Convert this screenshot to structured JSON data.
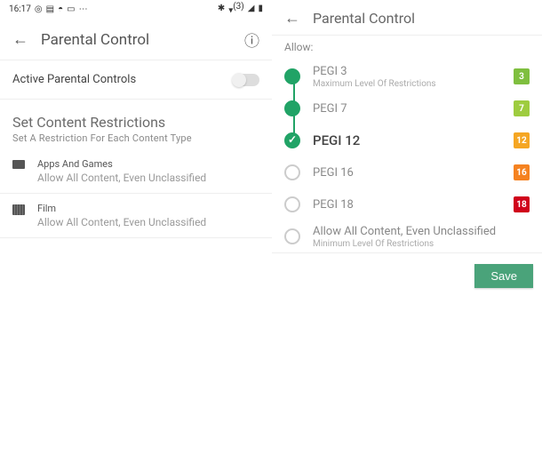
{
  "left": {
    "status": {
      "time": "16:17",
      "bt": "✱",
      "wifi_badge": "(3)"
    },
    "header": {
      "title": "Parental Control"
    },
    "toggle": {
      "label": "Active Parental Controls"
    },
    "section": {
      "title": "Set Content Restrictions",
      "subtitle": "Set A Restriction For Each Content Type"
    },
    "rows": [
      {
        "title": "Apps And Games",
        "sub": "Allow All Content, Even Unclassified"
      },
      {
        "title": "Film",
        "sub": "Allow All Content, Even Unclassified"
      }
    ]
  },
  "right": {
    "header": {
      "title": "Parental Control"
    },
    "allow_label": "Allow:",
    "options": [
      {
        "label": "PEGI 3",
        "sub": "Maximum Level Of Restrictions",
        "badge": "3",
        "badge_class": "g3",
        "state": "filled",
        "connect": true
      },
      {
        "label": "PEGI 7",
        "sub": "",
        "badge": "7",
        "badge_class": "g7",
        "state": "filled",
        "connect": true
      },
      {
        "label": "PEGI 12",
        "sub": "",
        "badge": "12",
        "badge_class": "g12",
        "state": "checked",
        "selected": true,
        "connect": false
      },
      {
        "label": "PEGI 16",
        "sub": "",
        "badge": "16",
        "badge_class": "g16",
        "state": "empty",
        "connect": false
      },
      {
        "label": "PEGI 18",
        "sub": "",
        "badge": "18",
        "badge_class": "g18",
        "state": "empty",
        "connect": false
      },
      {
        "label": "Allow All Content, Even Unclassified",
        "sub": "Minimum Level Of Restrictions",
        "badge": "",
        "badge_class": "",
        "state": "empty",
        "connect": false
      }
    ],
    "save_label": "Save"
  }
}
